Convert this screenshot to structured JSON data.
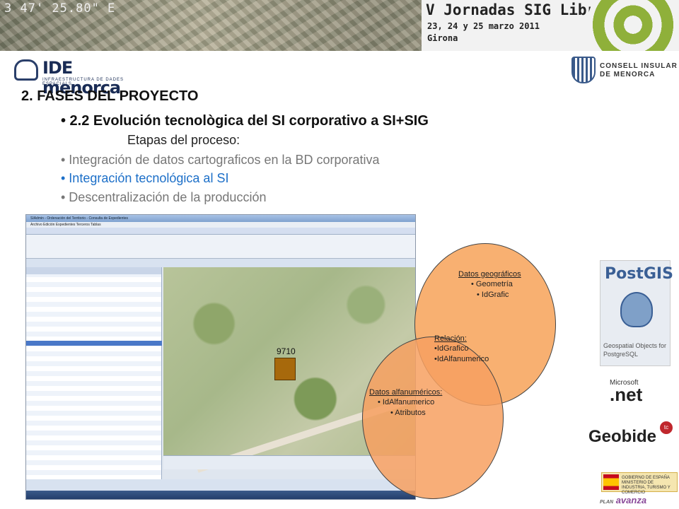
{
  "banner": {
    "coords": "3 47' 25.80\" E",
    "event_title": "V Jornadas SIG Libre",
    "event_dates": "23, 24 y 25 marzo 2011",
    "event_place": "Girona"
  },
  "logos": {
    "ide_name": "IDE menorca",
    "ide_sub": "INFRAESTRUCTURA DE DADES ESPACIALS",
    "consell_l1": "CONSELL INSULAR",
    "consell_l2": "DE MENORCA",
    "postgis_title": "PostGIS",
    "postgis_sub": "Geospatial Objects for PostgreSQL",
    "net_brand": "Microsoft",
    "net_name": ".net",
    "geobide": "Geobide",
    "geobide_badge": "tc",
    "gobierno": "GOBIERNO DE ESPAÑA  MINISTERIO DE INDUSTRIA, TURISMO Y COMERCIO",
    "plan": "PLAN",
    "avanza": "avanza"
  },
  "slide": {
    "heading": "2. FASES DEL PROYECTO",
    "subheading": "• 2.2 Evolución tecnològica del SI corporativo a SI+SIG",
    "etapas": "Etapas del proceso:",
    "bullet1": "• Integración de datos cartograficos en la BD corporativa",
    "bullet2": "• Integración tecnológica al SI",
    "bullet3": "• Descentralización de la producción"
  },
  "app": {
    "window_title": "SIAdmin - Ordenación del Territorio - Consulta de Expedientes",
    "menu": "Archivo   Edición   Expedientes   Terceros   Tablas",
    "parcel_label": "9710"
  },
  "venn": {
    "geo_title": "Datos geográficos",
    "geo_item1": "• Geometría",
    "geo_item2": "• IdGrafic",
    "rel_title": "Relación:",
    "rel_item1": "•IdGrafico",
    "rel_item2": "•IdAlfanumerico",
    "alfa_title": "Datos alfanuméricos:",
    "alfa_item1": "• IdAlfanumerico",
    "alfa_item2": "• Atributos"
  }
}
